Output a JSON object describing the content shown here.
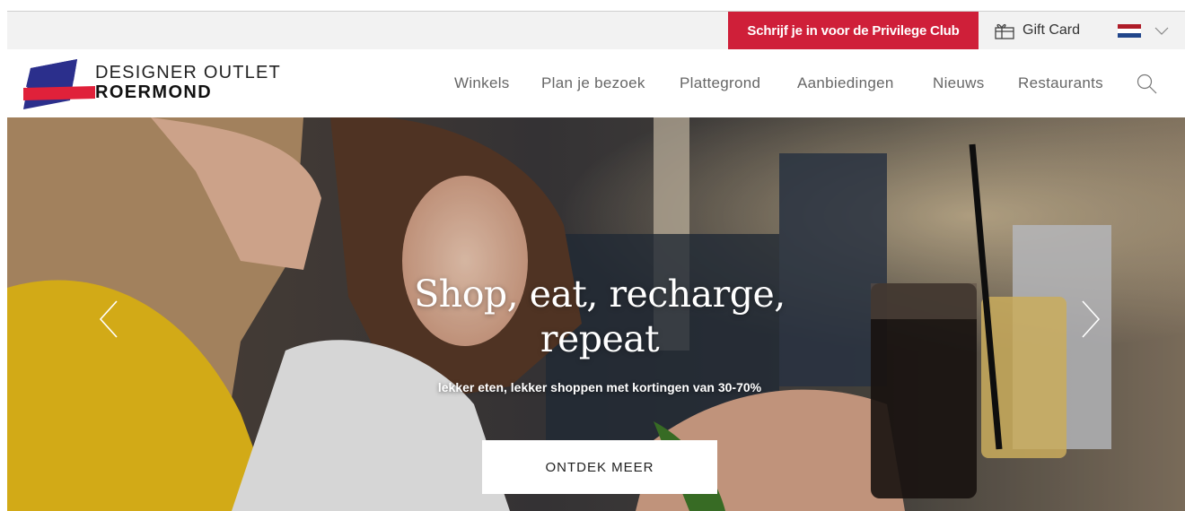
{
  "topbar": {
    "privilege_label": "Schrijf je in voor de Privilege Club",
    "giftcard_label": "Gift Card",
    "giftcard_icon": "gift-icon",
    "language_icon": "flag-nl-icon",
    "flag_colors": [
      "#ae1c28",
      "#ffffff",
      "#21468b"
    ],
    "chevron_icon": "chevron-down-icon",
    "accent": "#cf1f39"
  },
  "header": {
    "brand_line1": "DESIGNER OUTLET",
    "brand_line2": "ROERMOND",
    "logo_colors": [
      "#2b2f8c",
      "#e0213a"
    ],
    "nav": [
      "Winkels",
      "Plan je bezoek",
      "Plattegrond",
      "Aanbiedingen",
      "Nieuws",
      "Restaurants"
    ],
    "search_icon": "search-icon"
  },
  "hero": {
    "title": "Shop, eat, recharge, repeat",
    "subtitle": "lekker eten, lekker shoppen met kortingen van 30-70%",
    "cta_label": "ONTDEK MEER",
    "prev_icon": "chevron-left-icon",
    "next_icon": "chevron-right-icon"
  }
}
